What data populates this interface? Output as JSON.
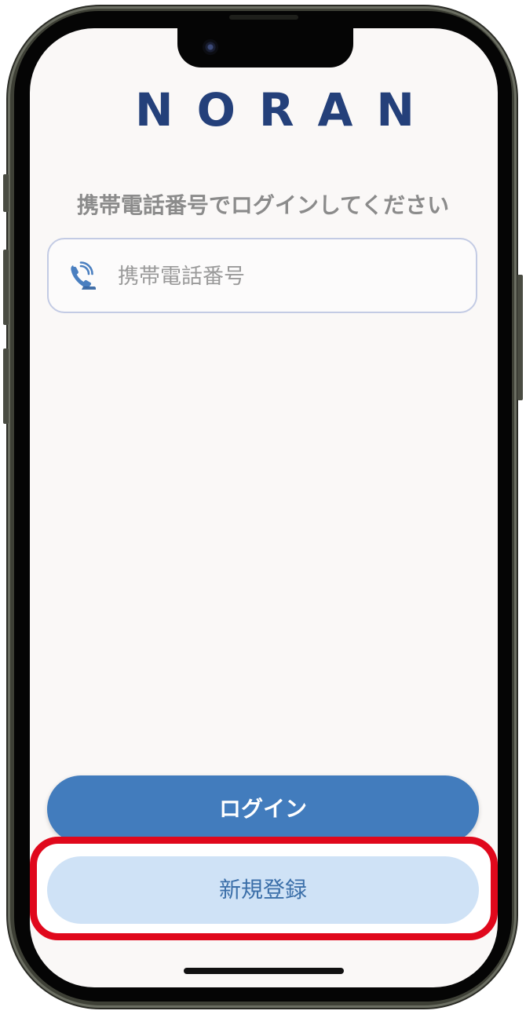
{
  "app": {
    "logo_text": "NORAN",
    "brand_color": "#24407a",
    "accent_color": "#427cbd"
  },
  "login": {
    "prompt": "携帯電話番号でログインしてください",
    "phone_input": {
      "placeholder": "携帯電話番号",
      "value": "",
      "icon": "phone-icon"
    },
    "login_button_label": "ログイン",
    "register_button_label": "新規登録"
  },
  "annotation": {
    "highlight_color": "#e0081c",
    "highlight_target": "register-button"
  }
}
